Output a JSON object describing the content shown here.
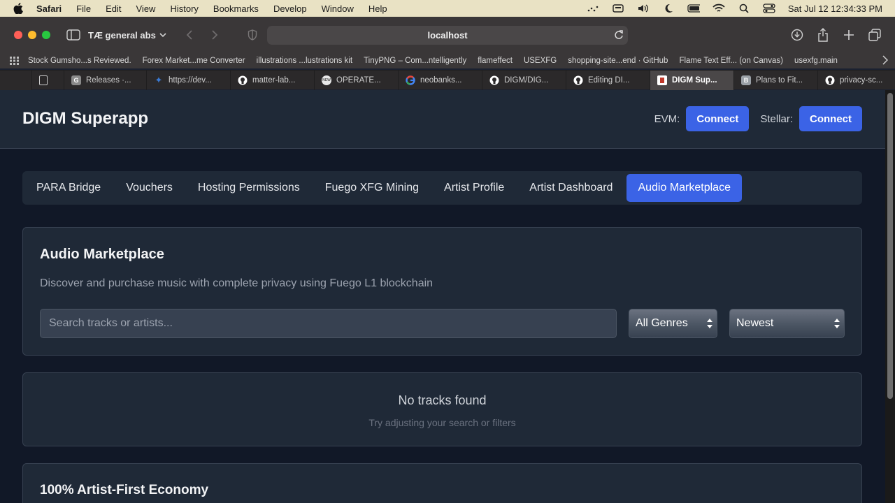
{
  "menubar": {
    "app_name": "Safari",
    "items": [
      "File",
      "Edit",
      "View",
      "History",
      "Bookmarks",
      "Develop",
      "Window",
      "Help"
    ],
    "clock": "Sat Jul 12  12:34:33 PM"
  },
  "toolbar": {
    "profile": "TÆ general abs",
    "url": "localhost"
  },
  "bookmarks": [
    "Stock Gumsho...s Reviewed.",
    "Forex Market...me Converter",
    "illustrations ...lustrations kit",
    "TinyPNG – Com...ntelligently",
    "flameffect",
    "USEXFG",
    "shopping-site...end · GitHub",
    "Flame Text Eff... (on Canvas)",
    "usexfg.main"
  ],
  "tabs": [
    {
      "label": "Releases ·...",
      "fav": "G",
      "fav_color": "#8a8a8a"
    },
    {
      "label": "https://dev...",
      "fav": "✦",
      "fav_color": "#3a7bd5"
    },
    {
      "label": "matter-lab...",
      "fav": "",
      "fav_color": "#ffffff"
    },
    {
      "label": "OPERATE...",
      "fav": "NEW",
      "fav_color": "#9aa0a6"
    },
    {
      "label": "neobanks...",
      "fav": "G",
      "fav_color": "#ffffff"
    },
    {
      "label": "DIGM/DIG...",
      "fav": "",
      "fav_color": "#ffffff"
    },
    {
      "label": "Editing DI...",
      "fav": "",
      "fav_color": "#ffffff"
    },
    {
      "label": "DIGM Sup...",
      "fav": "",
      "fav_color": "#c0392b"
    },
    {
      "label": "Plans to Fit...",
      "fav": "B",
      "fav_color": "#9aa0a6"
    },
    {
      "label": "privacy-sc...",
      "fav": "",
      "fav_color": "#ffffff"
    }
  ],
  "app": {
    "title": "DIGM Superapp",
    "evm_label": "EVM:",
    "evm_button": "Connect",
    "stellar_label": "Stellar:",
    "stellar_button": "Connect"
  },
  "nav": [
    {
      "label": "PARA Bridge",
      "active": false
    },
    {
      "label": "Vouchers",
      "active": false
    },
    {
      "label": "Hosting Permissions",
      "active": false
    },
    {
      "label": "Fuego XFG Mining",
      "active": false
    },
    {
      "label": "Artist Profile",
      "active": false
    },
    {
      "label": "Artist Dashboard",
      "active": false
    },
    {
      "label": "Audio Marketplace",
      "active": true
    }
  ],
  "marketplace": {
    "title": "Audio Marketplace",
    "description": "Discover and purchase music with complete privacy using Fuego L1 blockchain",
    "search_placeholder": "Search tracks or artists...",
    "search_value": "",
    "genre_selected": "All Genres",
    "sort_selected": "Newest"
  },
  "empty_state": {
    "title": "No tracks found",
    "subtitle": "Try adjusting your search or filters"
  },
  "economy": {
    "title": "100% Artist-First Economy"
  },
  "colors": {
    "accent": "#3b63e6",
    "page_bg": "#111827",
    "card_bg": "#1f2937"
  }
}
